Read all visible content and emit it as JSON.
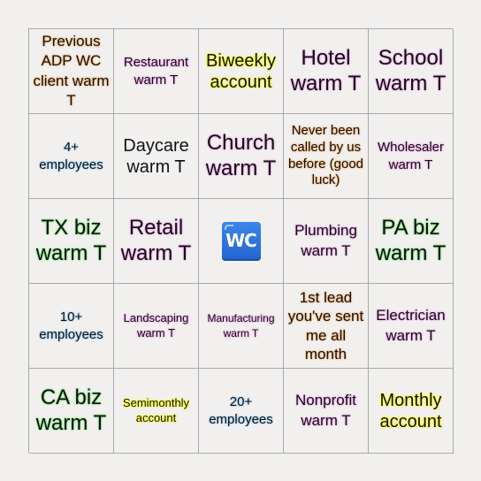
{
  "board": {
    "cells": [
      {
        "text": "Previous ADP WC client warm T",
        "glow": "orange"
      },
      {
        "text": "Restaurant warm T",
        "glow": "pink"
      },
      {
        "text": "Biweekly account",
        "glow": "yellow"
      },
      {
        "text": "Hotel warm T",
        "glow": "pink"
      },
      {
        "text": "School warm T",
        "glow": "pink"
      },
      {
        "text": "4+ employees",
        "glow": "blue"
      },
      {
        "text": "Daycare warm T",
        "glow": "none"
      },
      {
        "text": "Church warm T",
        "glow": "pink"
      },
      {
        "text": "Never been called by us before (good luck)",
        "glow": "orange"
      },
      {
        "text": "Wholesaler warm T",
        "glow": "pink"
      },
      {
        "text": "TX biz warm T",
        "glow": "green"
      },
      {
        "text": "Retail warm T",
        "glow": "pink"
      },
      {
        "text": "WC",
        "icon": "water-closet-icon",
        "free_space": true
      },
      {
        "text": "Plumbing warm T",
        "glow": "pink"
      },
      {
        "text": "PA biz warm T",
        "glow": "green"
      },
      {
        "text": "10+ employees",
        "glow": "blue"
      },
      {
        "text": "Landscaping warm T",
        "glow": "pink"
      },
      {
        "text": "Manufacturing warm T",
        "glow": "pink"
      },
      {
        "text": "1st lead you've sent me all month",
        "glow": "orange"
      },
      {
        "text": "Electrician warm T",
        "glow": "pink"
      },
      {
        "text": "CA biz warm T",
        "glow": "green"
      },
      {
        "text": "Semimonthly account",
        "glow": "yellow"
      },
      {
        "text": "20+ employees",
        "glow": "blue"
      },
      {
        "text": "Nonprofit warm T",
        "glow": "pink"
      },
      {
        "text": "Monthly account",
        "glow": "yellow"
      }
    ]
  },
  "colors": {
    "background": "#f2f0ef",
    "grid_line": "#a9a9a9",
    "glow_orange": "#f7b77a",
    "glow_pink": "#f4a8f0",
    "glow_yellow": "#ffff33",
    "glow_blue": "#9fd0f5",
    "glow_green": "#7fe87f",
    "wc_icon_blue": "#2a6fd8"
  }
}
